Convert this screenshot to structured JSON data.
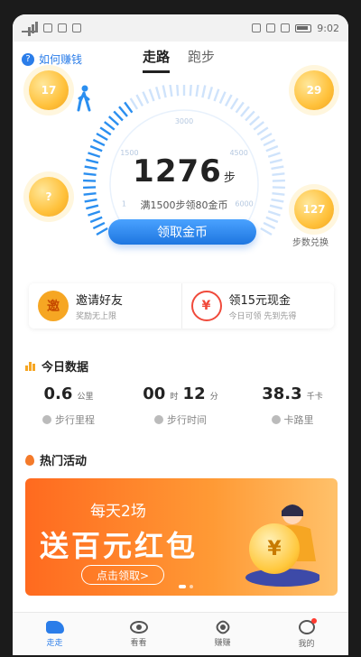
{
  "status_bar": {
    "time": "9:02",
    "battery": "100"
  },
  "top": {
    "help_label": "如何赚钱",
    "tabs": [
      {
        "label": "走路",
        "active": true
      },
      {
        "label": "跑步",
        "active": false
      }
    ]
  },
  "dial": {
    "ticks": [
      "1500",
      "3000",
      "4500",
      "6000",
      "1"
    ],
    "steps": "1276",
    "steps_unit": "步",
    "subtext": "满1500步领80金币"
  },
  "coins": [
    {
      "value": "17"
    },
    {
      "value": "29"
    },
    {
      "value": "?"
    },
    {
      "value": "127"
    }
  ],
  "coin_exchange_label": "步数兑换",
  "claim_button": "领取金币",
  "cards": [
    {
      "icon": "邀",
      "title": "邀请好友",
      "subtitle": "奖励无上限"
    },
    {
      "icon": "¥",
      "title": "领15元现金",
      "subtitle": "今日可领 先到先得"
    }
  ],
  "today": {
    "title": "今日数据",
    "stats": [
      {
        "value": "0.6",
        "unit": "公里",
        "label": "步行里程"
      },
      {
        "value": "00",
        "unit": "时",
        "value2": "12",
        "unit2": "分",
        "label": "步行时间"
      },
      {
        "value": "38.3",
        "unit": "千卡",
        "label": "卡路里"
      }
    ]
  },
  "activities": {
    "title": "热门活动",
    "banner": {
      "line1": "每天2场",
      "line2": "送百元红包",
      "cta": "点击领取>",
      "coin": "¥"
    }
  },
  "tabbar": [
    {
      "label": "走走",
      "active": true
    },
    {
      "label": "看看",
      "active": false
    },
    {
      "label": "赚赚",
      "active": false
    },
    {
      "label": "我的",
      "active": false
    }
  ],
  "colors": {
    "accent": "#2b7de9",
    "coin": "#ffc13b",
    "banner": "#ff6a1f"
  }
}
